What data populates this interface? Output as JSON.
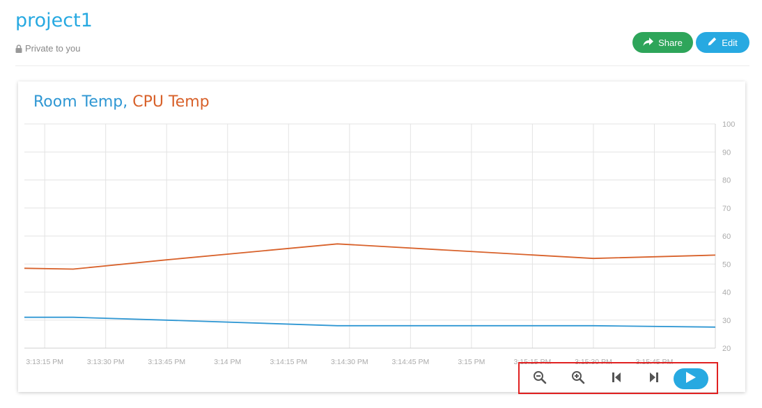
{
  "header": {
    "title": "project1",
    "privacy": "Private to you",
    "share_label": "Share",
    "edit_label": "Edit"
  },
  "chart_title": {
    "series1": "Room Temp,",
    "series2": "CPU Temp"
  },
  "colors": {
    "accent": "#27a9e1",
    "share": "#2ea55a",
    "room_temp": "#2f97d3",
    "cpu_temp": "#d8612a"
  },
  "icons": [
    "lock-icon",
    "share-arrow-icon",
    "pencil-icon",
    "zoom-out-icon",
    "zoom-in-icon",
    "skip-back-icon",
    "skip-forward-icon",
    "play-icon"
  ],
  "chart_data": {
    "type": "line",
    "title": "Room Temp, CPU Temp",
    "xlabel": "",
    "ylabel": "",
    "ylim": [
      20,
      100
    ],
    "y_ticks": [
      20,
      30,
      40,
      50,
      60,
      70,
      80,
      90,
      100
    ],
    "x_ticks": [
      "3:13:15 PM",
      "3:13:30 PM",
      "3:13:45 PM",
      "3:14 PM",
      "3:14:15 PM",
      "3:14:30 PM",
      "3:14:45 PM",
      "3:15 PM",
      "3:15:15 PM",
      "3:15:30 PM",
      "3:15:45 PM"
    ],
    "x_range": [
      "3:13:10 PM",
      "3:16:00 PM"
    ],
    "grid": true,
    "y_axis_side": "right",
    "series": [
      {
        "name": "Room Temp",
        "color": "#2f97d3",
        "points": [
          {
            "x": "3:13:10 PM",
            "y": 31
          },
          {
            "x": "3:13:22 PM",
            "y": 31
          },
          {
            "x": "3:13:45 PM",
            "y": 30
          },
          {
            "x": "3:14:27 PM",
            "y": 28
          },
          {
            "x": "3:15:30 PM",
            "y": 28
          },
          {
            "x": "3:16:00 PM",
            "y": 27.5
          }
        ]
      },
      {
        "name": "CPU Temp",
        "color": "#d8612a",
        "points": [
          {
            "x": "3:13:10 PM",
            "y": 48.5
          },
          {
            "x": "3:13:22 PM",
            "y": 48.2
          },
          {
            "x": "3:13:45 PM",
            "y": 51.5
          },
          {
            "x": "3:14:27 PM",
            "y": 57.2
          },
          {
            "x": "3:15:30 PM",
            "y": 52
          },
          {
            "x": "3:16:00 PM",
            "y": 53.2
          }
        ]
      }
    ]
  }
}
